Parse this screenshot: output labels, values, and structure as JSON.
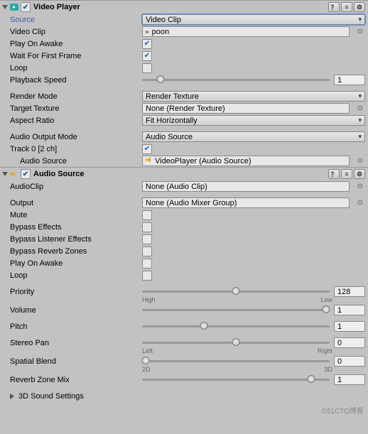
{
  "videoPlayer": {
    "title": "Video Player",
    "source": {
      "label": "Source",
      "value": "Video Clip"
    },
    "videoClip": {
      "label": "Video Clip",
      "value": "poon"
    },
    "playOnAwake": {
      "label": "Play On Awake",
      "checked": true
    },
    "waitForFirstFrame": {
      "label": "Wait For First Frame",
      "checked": true
    },
    "loop": {
      "label": "Loop",
      "checked": false
    },
    "playbackSpeed": {
      "label": "Playback Speed",
      "value": "1",
      "pos": 10
    },
    "renderMode": {
      "label": "Render Mode",
      "value": "Render Texture"
    },
    "targetTexture": {
      "label": "Target Texture",
      "value": "None (Render Texture)"
    },
    "aspectRatio": {
      "label": "Aspect Ratio",
      "value": "Fit Horizontally"
    },
    "audioOutputMode": {
      "label": "Audio Output Mode",
      "value": "Audio Source"
    },
    "track0": {
      "label": "Track 0 [2 ch]",
      "checked": true
    },
    "audioSource": {
      "label": "Audio Source",
      "value": "VideoPlayer (Audio Source)"
    }
  },
  "audioSource": {
    "title": "Audio Source",
    "audioClip": {
      "label": "AudioClip",
      "value": "None (Audio Clip)"
    },
    "output": {
      "label": "Output",
      "value": "None (Audio Mixer Group)"
    },
    "mute": {
      "label": "Mute",
      "checked": false
    },
    "bypassEffects": {
      "label": "Bypass Effects",
      "checked": false
    },
    "bypassListenerEffects": {
      "label": "Bypass Listener Effects",
      "checked": false
    },
    "bypassReverbZones": {
      "label": "Bypass Reverb Zones",
      "checked": false
    },
    "playOnAwake": {
      "label": "Play On Awake",
      "checked": false
    },
    "loop": {
      "label": "Loop",
      "checked": false
    },
    "priority": {
      "label": "Priority",
      "value": "128",
      "pos": 50,
      "left": "High",
      "right": "Low"
    },
    "volume": {
      "label": "Volume",
      "value": "1",
      "pos": 98
    },
    "pitch": {
      "label": "Pitch",
      "value": "1",
      "pos": 33
    },
    "stereoPan": {
      "label": "Stereo Pan",
      "value": "0",
      "pos": 50,
      "left": "Left",
      "right": "Right"
    },
    "spatialBlend": {
      "label": "Spatial Blend",
      "value": "0",
      "pos": 2,
      "left": "2D",
      "right": "3D"
    },
    "reverbZoneMix": {
      "label": "Reverb Zone Mix",
      "value": "1",
      "pos": 90
    }
  },
  "soundSettings": {
    "label": "3D Sound Settings"
  },
  "watermark": "©51CTO博客"
}
